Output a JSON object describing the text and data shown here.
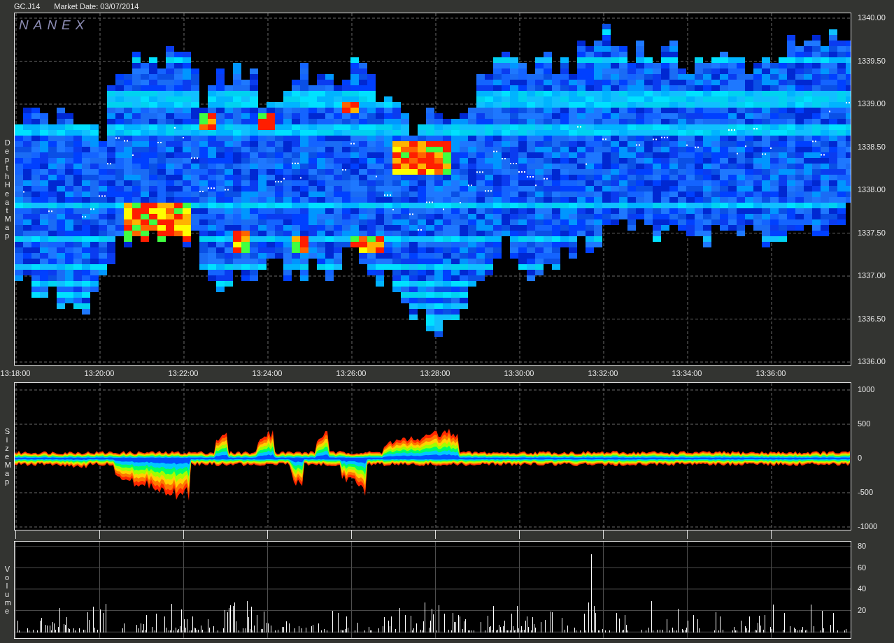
{
  "header": {
    "symbol": "GC.J14",
    "market_date": "Market Date: 03/07/2014"
  },
  "heat_map": {
    "label": "Depth Heat Map",
    "logo": "NANEX",
    "ticks": [
      "1340.00",
      "1339.50",
      "1339.00",
      "1338.50",
      "1338.00",
      "1337.50",
      "1337.00",
      "1336.50",
      "1336.00"
    ]
  },
  "time_ticks": [
    "13:18:00",
    "13:20:00",
    "13:22:00",
    "13:24:00",
    "13:26:00",
    "13:28:00",
    "13:30:00",
    "13:32:00",
    "13:34:00",
    "13:36:00"
  ],
  "size_map": {
    "label": "Size Map",
    "ticks": [
      "1000",
      "500",
      "0",
      "-500",
      "-1000"
    ]
  },
  "volume": {
    "label": "Volume",
    "ticks": [
      "80",
      "60",
      "40",
      "20"
    ]
  }
}
